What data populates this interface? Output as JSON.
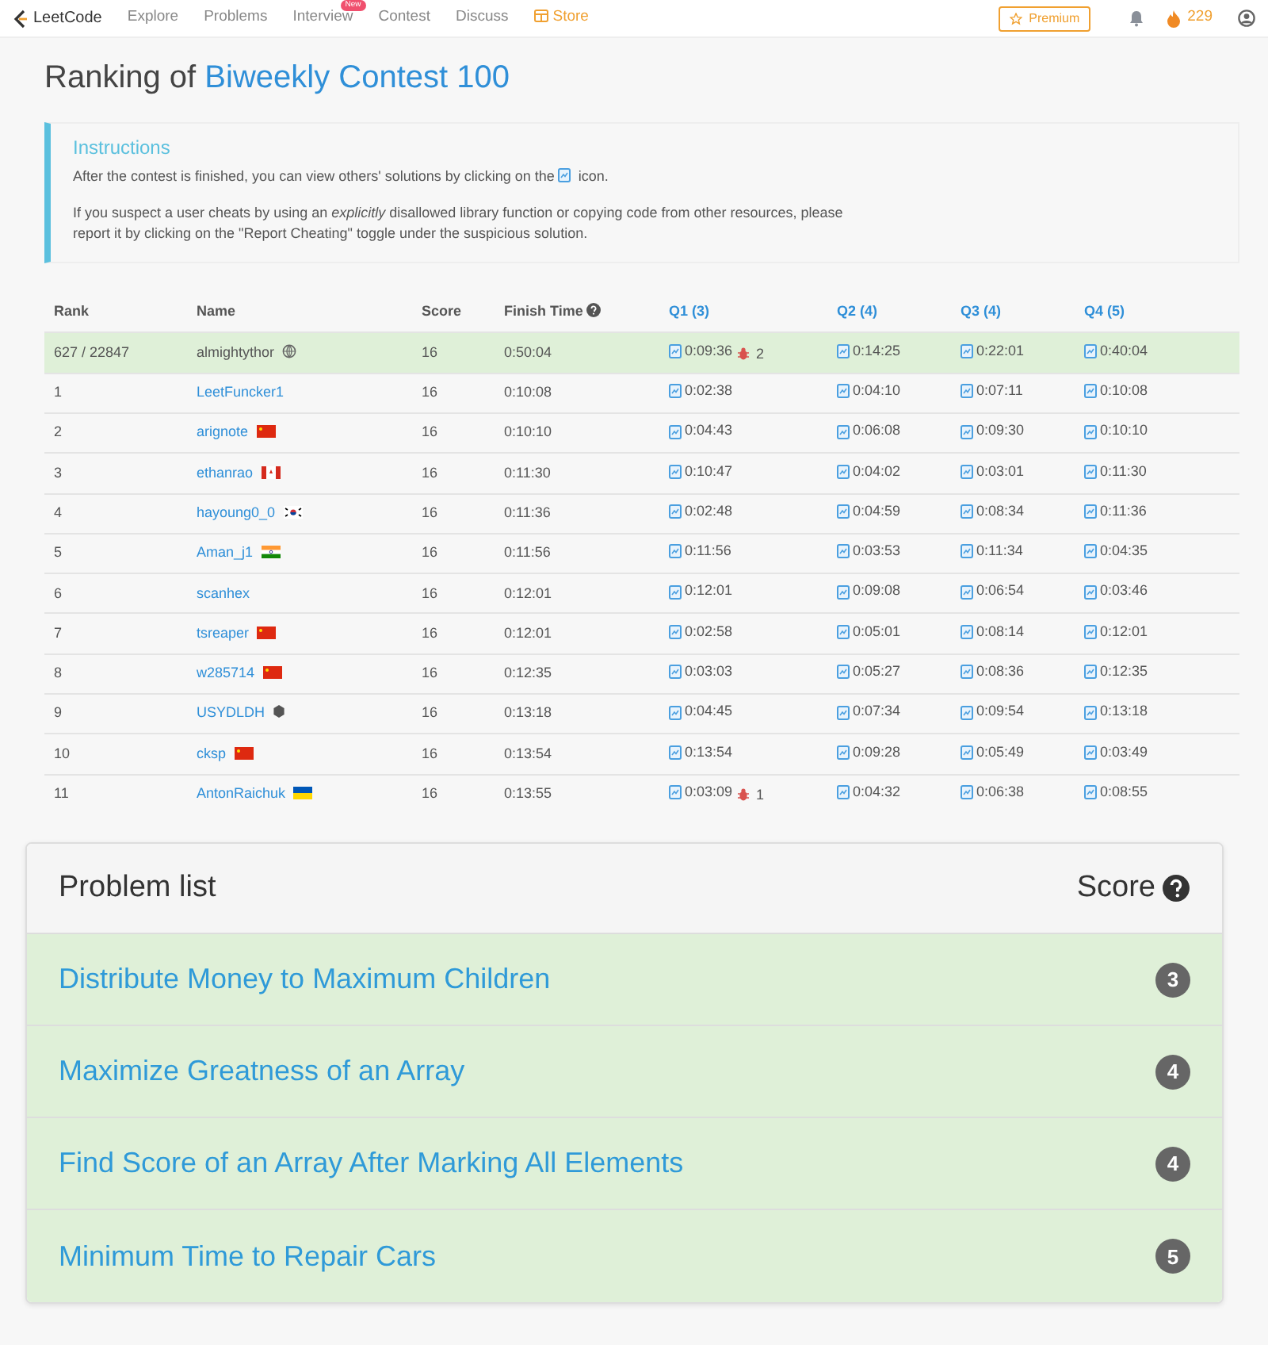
{
  "navbar": {
    "brand": "LeetCode",
    "links": [
      {
        "label": "Explore",
        "kind": "plain"
      },
      {
        "label": "Problems",
        "kind": "plain"
      },
      {
        "label": "Interview",
        "kind": "plain",
        "badge": "New"
      },
      {
        "label": "Contest",
        "kind": "plain"
      },
      {
        "label": "Discuss",
        "kind": "plain"
      },
      {
        "label": "Store",
        "kind": "store"
      }
    ],
    "premium": "Premium",
    "streak": "229"
  },
  "heading": {
    "prefix": "Ranking of",
    "contest": "Biweekly Contest 100"
  },
  "instructions": {
    "title": "Instructions",
    "line1_before": "After the contest is finished, you can view others' solutions by clicking on the",
    "line1_after": "icon.",
    "line2": "If you suspect a user cheats by using an *explicitly* disallowed library function or copying code from other resources, please report it by clicking on the \"Report Cheating\" toggle under the suspicious solution."
  },
  "table": {
    "columns": [
      "Rank",
      "Name",
      "Score",
      "Finish Time",
      "Q1 (3)",
      "Q2 (4)",
      "Q3 (4)",
      "Q4 (5)"
    ],
    "rows": [
      {
        "rank": "627 / 22847",
        "name": "almightythor",
        "kind": "globe",
        "score": "16",
        "finish": "0:50:04",
        "highlighted": true,
        "q": [
          {
            "time": "0:09:36",
            "wrong": "2"
          },
          {
            "time": "0:14:25"
          },
          {
            "time": "0:22:01"
          },
          {
            "time": "0:40:04"
          }
        ]
      },
      {
        "rank": "1",
        "name": "LeetFuncker1",
        "score": "16",
        "finish": "0:10:08",
        "highlighted": false,
        "q": [
          {
            "time": "0:02:38"
          },
          {
            "time": "0:04:10"
          },
          {
            "time": "0:07:11"
          },
          {
            "time": "0:10:08"
          }
        ]
      },
      {
        "rank": "2",
        "name": "arignote",
        "kind": "cn",
        "score": "16",
        "finish": "0:10:10",
        "highlighted": false,
        "q": [
          {
            "time": "0:04:43"
          },
          {
            "time": "0:06:08"
          },
          {
            "time": "0:09:30"
          },
          {
            "time": "0:10:10"
          }
        ]
      },
      {
        "rank": "3",
        "name": "ethanrao",
        "kind": "ca",
        "score": "16",
        "finish": "0:11:30",
        "highlighted": false,
        "q": [
          {
            "time": "0:10:47"
          },
          {
            "time": "0:04:02"
          },
          {
            "time": "0:03:01"
          },
          {
            "time": "0:11:30"
          }
        ]
      },
      {
        "rank": "4",
        "name": "hayoung0_0",
        "kind": "kr",
        "score": "16",
        "finish": "0:11:36",
        "highlighted": false,
        "q": [
          {
            "time": "0:02:48"
          },
          {
            "time": "0:04:59"
          },
          {
            "time": "0:08:34"
          },
          {
            "time": "0:11:36"
          }
        ]
      },
      {
        "rank": "5",
        "name": "Aman_j1",
        "kind": "in",
        "score": "16",
        "finish": "0:11:56",
        "highlighted": false,
        "q": [
          {
            "time": "0:11:56"
          },
          {
            "time": "0:03:53"
          },
          {
            "time": "0:11:34"
          },
          {
            "time": "0:04:35"
          }
        ]
      },
      {
        "rank": "6",
        "name": "scanhex",
        "score": "16",
        "finish": "0:12:01",
        "highlighted": false,
        "q": [
          {
            "time": "0:12:01"
          },
          {
            "time": "0:09:08"
          },
          {
            "time": "0:06:54"
          },
          {
            "time": "0:03:46"
          }
        ]
      },
      {
        "rank": "7",
        "name": "tsreaper",
        "kind": "cn",
        "score": "16",
        "finish": "0:12:01",
        "highlighted": false,
        "q": [
          {
            "time": "0:02:58"
          },
          {
            "time": "0:05:01"
          },
          {
            "time": "0:08:14"
          },
          {
            "time": "0:12:01"
          }
        ]
      },
      {
        "rank": "8",
        "name": "w285714",
        "kind": "cn",
        "score": "16",
        "finish": "0:12:35",
        "highlighted": false,
        "q": [
          {
            "time": "0:03:03"
          },
          {
            "time": "0:05:27"
          },
          {
            "time": "0:08:36"
          },
          {
            "time": "0:12:35"
          }
        ]
      },
      {
        "rank": "9",
        "name": "USYDLDH",
        "kind": "hex",
        "score": "16",
        "finish": "0:13:18",
        "highlighted": false,
        "q": [
          {
            "time": "0:04:45"
          },
          {
            "time": "0:07:34"
          },
          {
            "time": "0:09:54"
          },
          {
            "time": "0:13:18"
          }
        ]
      },
      {
        "rank": "10",
        "name": "cksp",
        "kind": "cn",
        "score": "16",
        "finish": "0:13:54",
        "highlighted": false,
        "q": [
          {
            "time": "0:13:54"
          },
          {
            "time": "0:09:28"
          },
          {
            "time": "0:05:49"
          },
          {
            "time": "0:03:49"
          }
        ]
      },
      {
        "rank": "11",
        "name": "AntonRaichuk",
        "kind": "ua",
        "score": "16",
        "finish": "0:13:55",
        "highlighted": false,
        "q": [
          {
            "time": "0:03:09",
            "wrong": "1"
          },
          {
            "time": "0:04:32"
          },
          {
            "time": "0:06:38"
          },
          {
            "time": "0:08:55"
          }
        ]
      }
    ]
  },
  "problem_list": {
    "title": "Problem list",
    "score_label": "Score",
    "problems": [
      {
        "title": "Distribute Money to Maximum Children",
        "score": "3"
      },
      {
        "title": "Maximize Greatness of an Array",
        "score": "4"
      },
      {
        "title": "Find Score of an Array After Marking All Elements",
        "score": "4"
      },
      {
        "title": "Minimum Time to Repair Cars",
        "score": "5"
      }
    ]
  }
}
